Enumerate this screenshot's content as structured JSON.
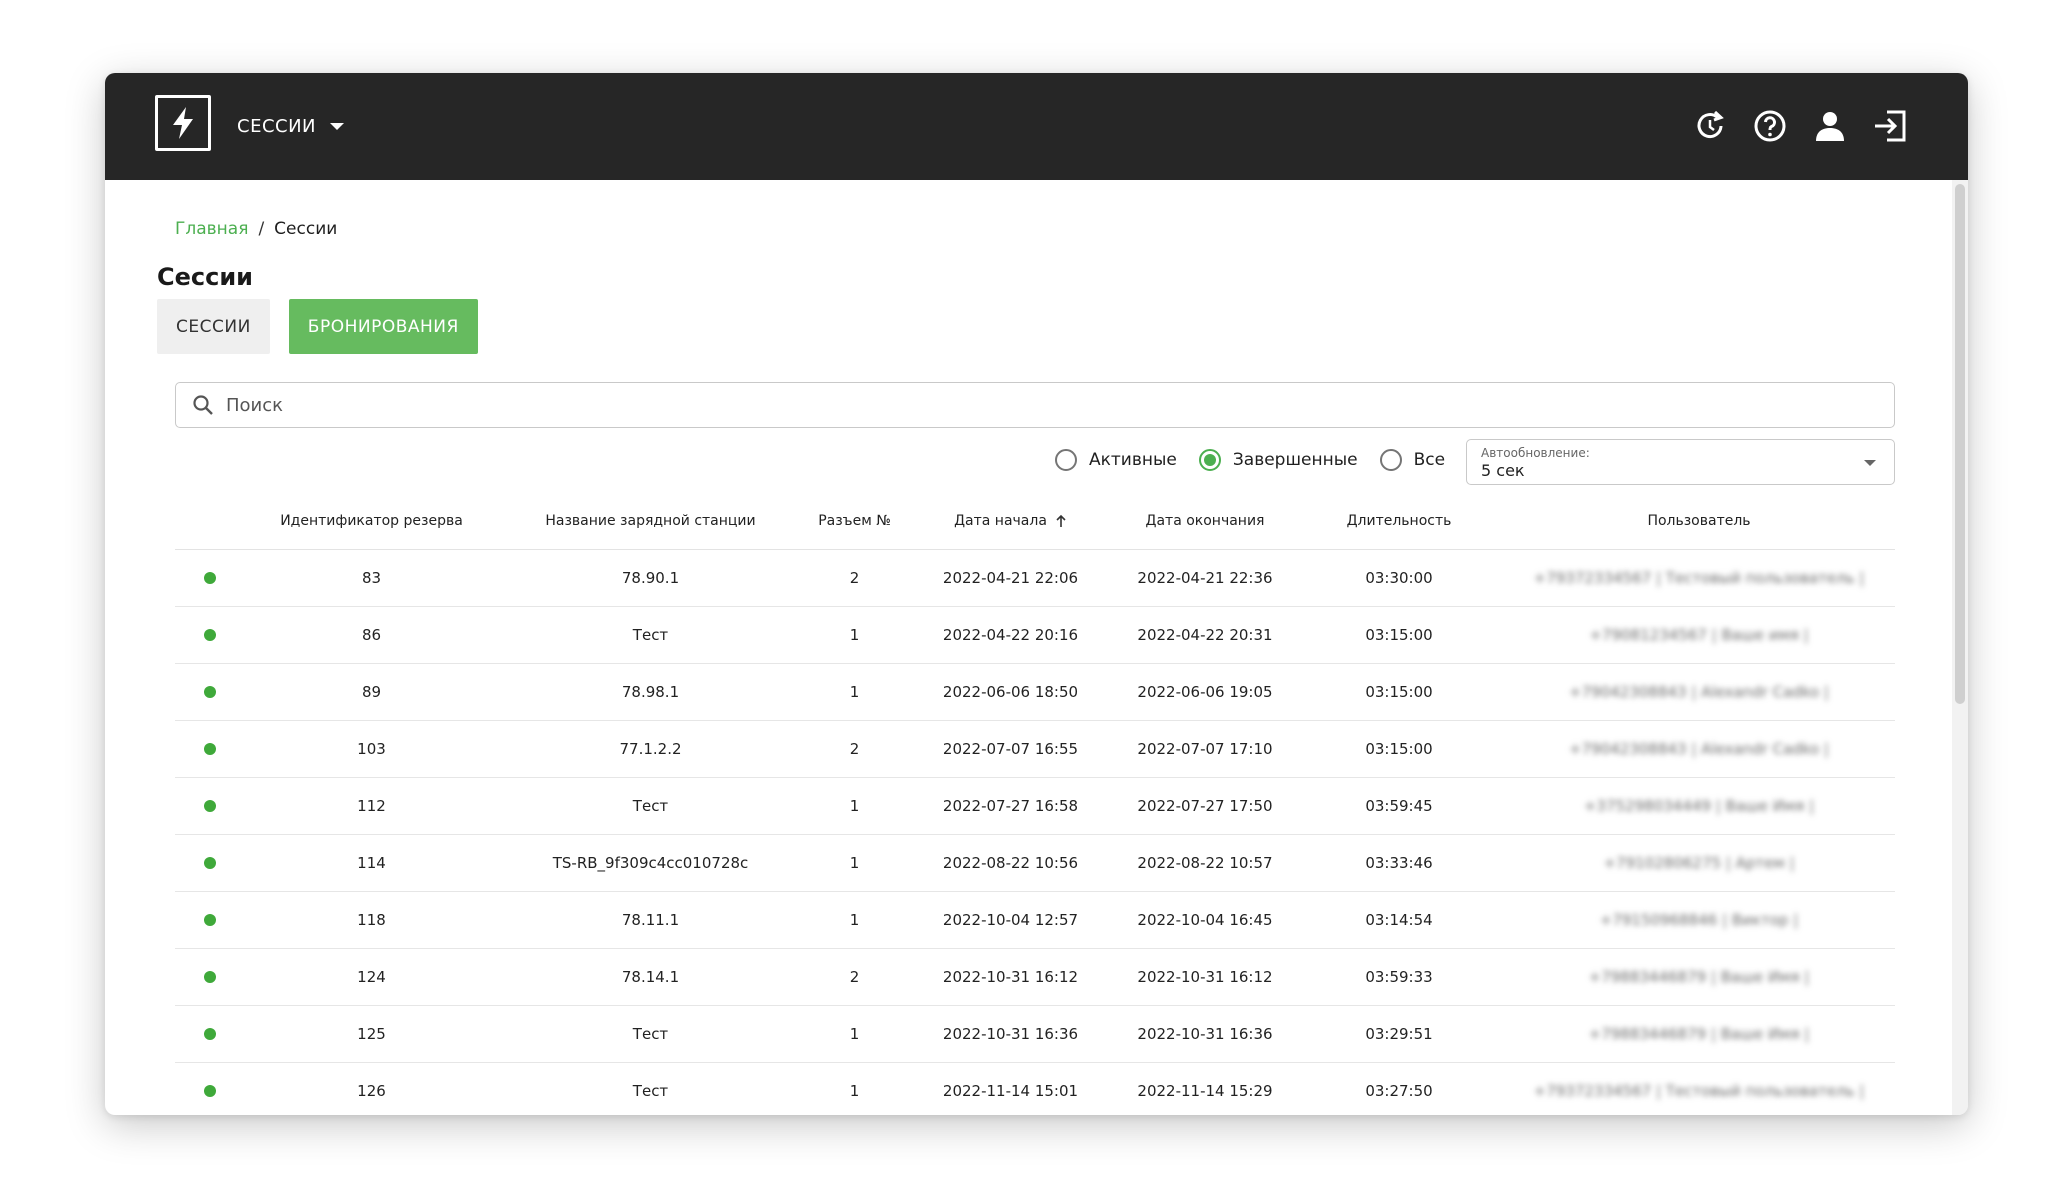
{
  "header": {
    "menu_label": "СЕССИИ",
    "logo_icon": "lightning-bolt-icon",
    "icons": [
      "refresh-clock-icon",
      "help-circle-icon",
      "user-icon",
      "logout-icon"
    ]
  },
  "breadcrumb": {
    "home": "Главная",
    "separator": "/",
    "current": "Сессии"
  },
  "page": {
    "title": "Сессии",
    "tabs": [
      {
        "label": "СЕССИИ",
        "active": false
      },
      {
        "label": "БРОНИРОВАНИЯ",
        "active": true
      }
    ]
  },
  "search": {
    "placeholder": "Поиск",
    "value": ""
  },
  "filters": {
    "options": [
      {
        "label": "Активные",
        "checked": false
      },
      {
        "label": "Завершенные",
        "checked": true
      },
      {
        "label": "Все",
        "checked": false
      }
    ],
    "autoupdate_label": "Автообновление:",
    "autoupdate_value": "5 сек"
  },
  "table": {
    "columns": {
      "id": "Идентификатор резерва",
      "station": "Название зарядной станции",
      "connector": "Разъем №",
      "start": "Дата начала",
      "end": "Дата окончания",
      "duration": "Длительность",
      "user": "Пользователь"
    },
    "status_color": "#3fa93a",
    "rows": [
      {
        "id": "83",
        "station": "78.90.1",
        "connector": "2",
        "start": "2022-04-21 22:06",
        "end": "2022-04-21 22:36",
        "duration": "03:30:00",
        "user": "+79372334567 | Тестовый пользователь |"
      },
      {
        "id": "86",
        "station": "Тест",
        "connector": "1",
        "start": "2022-04-22 20:16",
        "end": "2022-04-22 20:31",
        "duration": "03:15:00",
        "user": "+79081234567 | Ваше имя |"
      },
      {
        "id": "89",
        "station": "78.98.1",
        "connector": "1",
        "start": "2022-06-06 18:50",
        "end": "2022-06-06 19:05",
        "duration": "03:15:00",
        "user": "+79042308843 | Alexandr Cadko |"
      },
      {
        "id": "103",
        "station": "77.1.2.2",
        "connector": "2",
        "start": "2022-07-07 16:55",
        "end": "2022-07-07 17:10",
        "duration": "03:15:00",
        "user": "+79042308843 | Alexandr Cadko |"
      },
      {
        "id": "112",
        "station": "Тест",
        "connector": "1",
        "start": "2022-07-27 16:58",
        "end": "2022-07-27 17:50",
        "duration": "03:59:45",
        "user": "+375298034449 | Ваше Имя |"
      },
      {
        "id": "114",
        "station": "TS-RB_9f309c4cc010728c",
        "connector": "1",
        "start": "2022-08-22 10:56",
        "end": "2022-08-22 10:57",
        "duration": "03:33:46",
        "user": "+79102806275 | Артем |"
      },
      {
        "id": "118",
        "station": "78.11.1",
        "connector": "1",
        "start": "2022-10-04 12:57",
        "end": "2022-10-04 16:45",
        "duration": "03:14:54",
        "user": "+79150968846 | Виктор |"
      },
      {
        "id": "124",
        "station": "78.14.1",
        "connector": "2",
        "start": "2022-10-31 16:12",
        "end": "2022-10-31 16:12",
        "duration": "03:59:33",
        "user": "+79883446879 | Ваше Имя |"
      },
      {
        "id": "125",
        "station": "Тест",
        "connector": "1",
        "start": "2022-10-31 16:36",
        "end": "2022-10-31 16:36",
        "duration": "03:29:51",
        "user": "+79883446879 | Ваше Имя |"
      },
      {
        "id": "126",
        "station": "Тест",
        "connector": "1",
        "start": "2022-11-14 15:01",
        "end": "2022-11-14 15:29",
        "duration": "03:27:50",
        "user": "+79372334567 | Тестовый пользователь |"
      }
    ]
  }
}
